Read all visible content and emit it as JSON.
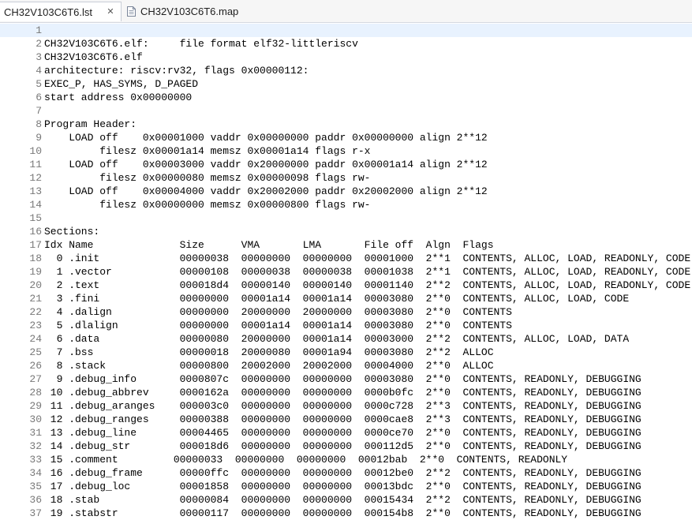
{
  "tabs": [
    {
      "label": "CH32V103C6T6.lst",
      "active": true,
      "icon": "close-icon"
    },
    {
      "label": "CH32V103C6T6.map",
      "active": false,
      "icon": "text-file-icon"
    }
  ],
  "lines": [
    {
      "n": "1",
      "text": ""
    },
    {
      "n": "2",
      "text": "CH32V103C6T6.elf:     file format elf32-littleriscv"
    },
    {
      "n": "3",
      "text": "CH32V103C6T6.elf"
    },
    {
      "n": "4",
      "text": "architecture: riscv:rv32, flags 0x00000112:"
    },
    {
      "n": "5",
      "text": "EXEC_P, HAS_SYMS, D_PAGED"
    },
    {
      "n": "6",
      "text": "start address 0x00000000"
    },
    {
      "n": "7",
      "text": ""
    },
    {
      "n": "8",
      "text": "Program Header:"
    },
    {
      "n": "9",
      "text": "    LOAD off    0x00001000 vaddr 0x00000000 paddr 0x00000000 align 2**12"
    },
    {
      "n": "10",
      "text": "         filesz 0x00001a14 memsz 0x00001a14 flags r-x"
    },
    {
      "n": "11",
      "text": "    LOAD off    0x00003000 vaddr 0x20000000 paddr 0x00001a14 align 2**12"
    },
    {
      "n": "12",
      "text": "         filesz 0x00000080 memsz 0x00000098 flags rw-"
    },
    {
      "n": "13",
      "text": "    LOAD off    0x00004000 vaddr 0x20002000 paddr 0x20002000 align 2**12"
    },
    {
      "n": "14",
      "text": "         filesz 0x00000000 memsz 0x00000800 flags rw-"
    },
    {
      "n": "15",
      "text": ""
    },
    {
      "n": "16",
      "text": "Sections:"
    },
    {
      "n": "17",
      "text": "Idx Name              Size      VMA       LMA       File off  Algn  Flags"
    },
    {
      "n": "18",
      "text": "  0 .init             00000038  00000000  00000000  00001000  2**1  CONTENTS, ALLOC, LOAD, READONLY, CODE"
    },
    {
      "n": "19",
      "text": "  1 .vector           00000108  00000038  00000038  00001038  2**1  CONTENTS, ALLOC, LOAD, READONLY, CODE"
    },
    {
      "n": "20",
      "text": "  2 .text             000018d4  00000140  00000140  00001140  2**2  CONTENTS, ALLOC, LOAD, READONLY, CODE"
    },
    {
      "n": "21",
      "text": "  3 .fini             00000000  00001a14  00001a14  00003080  2**0  CONTENTS, ALLOC, LOAD, CODE"
    },
    {
      "n": "22",
      "text": "  4 .dalign           00000000  20000000  20000000  00003080  2**0  CONTENTS"
    },
    {
      "n": "23",
      "text": "  5 .dlalign          00000000  00001a14  00001a14  00003080  2**0  CONTENTS"
    },
    {
      "n": "24",
      "text": "  6 .data             00000080  20000000  00001a14  00003000  2**2  CONTENTS, ALLOC, LOAD, DATA"
    },
    {
      "n": "25",
      "text": "  7 .bss              00000018  20000080  00001a94  00003080  2**2  ALLOC"
    },
    {
      "n": "26",
      "text": "  8 .stack            00000800  20002000  20002000  00004000  2**0  ALLOC"
    },
    {
      "n": "27",
      "text": "  9 .debug_info       0000807c  00000000  00000000  00003080  2**0  CONTENTS, READONLY, DEBUGGING"
    },
    {
      "n": "28",
      "text": " 10 .debug_abbrev     0000162a  00000000  00000000  0000b0fc  2**0  CONTENTS, READONLY, DEBUGGING"
    },
    {
      "n": "29",
      "text": " 11 .debug_aranges    000003c0  00000000  00000000  0000c728  2**3  CONTENTS, READONLY, DEBUGGING"
    },
    {
      "n": "30",
      "text": " 12 .debug_ranges     00000388  00000000  00000000  0000cae8  2**3  CONTENTS, READONLY, DEBUGGING"
    },
    {
      "n": "31",
      "text": " 13 .debug_line       00004465  00000000  00000000  0000ce70  2**0  CONTENTS, READONLY, DEBUGGING"
    },
    {
      "n": "32",
      "text": " 14 .debug_str        000018d6  00000000  00000000  000112d5  2**0  CONTENTS, READONLY, DEBUGGING"
    },
    {
      "n": "33",
      "text": " 15 .comment         00000033  00000000  00000000  00012bab  2**0  CONTENTS, READONLY"
    },
    {
      "n": "34",
      "text": " 16 .debug_frame      00000ffc  00000000  00000000  00012be0  2**2  CONTENTS, READONLY, DEBUGGING"
    },
    {
      "n": "35",
      "text": " 17 .debug_loc        00001858  00000000  00000000  00013bdc  2**0  CONTENTS, READONLY, DEBUGGING"
    },
    {
      "n": "36",
      "text": " 18 .stab             00000084  00000000  00000000  00015434  2**2  CONTENTS, READONLY, DEBUGGING"
    },
    {
      "n": "37",
      "text": " 19 .stabstr          00000117  00000000  00000000  000154b8  2**0  CONTENTS, READONLY, DEBUGGING"
    }
  ]
}
